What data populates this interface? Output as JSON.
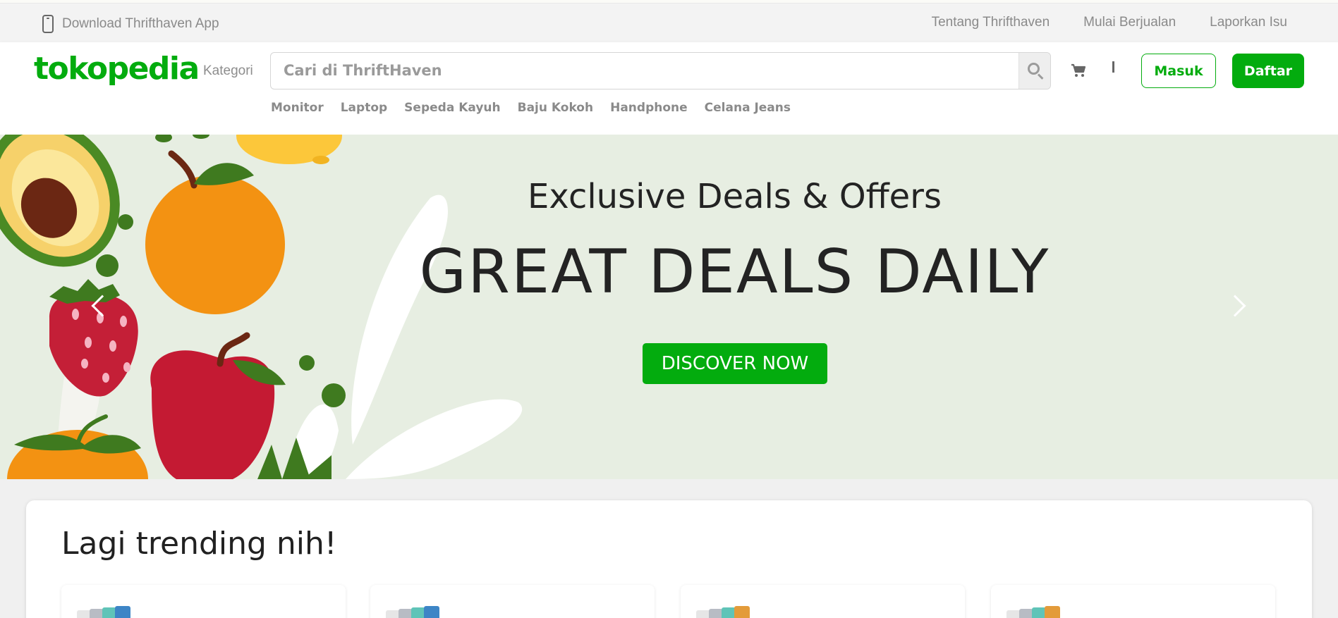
{
  "topbar": {
    "app_label": "Download Thrifthaven App",
    "links": [
      "Tentang Thrifthaven",
      "Mulai Berjualan",
      "Laporkan Isu"
    ]
  },
  "header": {
    "logo": "tokopedia",
    "category_label": "Kategori",
    "search_placeholder": "Cari di ThriftHaven",
    "login_label": "Masuk",
    "register_label": "Daftar",
    "separator": "|",
    "quick_links": [
      "Monitor",
      "Laptop",
      "Sepeda Kayuh",
      "Baju Kokoh",
      "Handphone",
      "Celana Jeans"
    ]
  },
  "banner": {
    "subtitle": "Exclusive Deals & Offers",
    "headline": "GREAT DEALS DAILY",
    "cta_label": "DISCOVER NOW"
  },
  "trending": {
    "title": "Lagi trending nih!",
    "products": [
      {},
      {},
      {},
      {}
    ]
  },
  "colors": {
    "brand": "#03ac0e",
    "banner_bg": "#e7eee2",
    "text_dark": "#232323",
    "muted": "#8a8a8a"
  },
  "icons": [
    "phone-icon",
    "search-icon",
    "cart-icon",
    "chevron-left-icon",
    "chevron-right-icon"
  ]
}
